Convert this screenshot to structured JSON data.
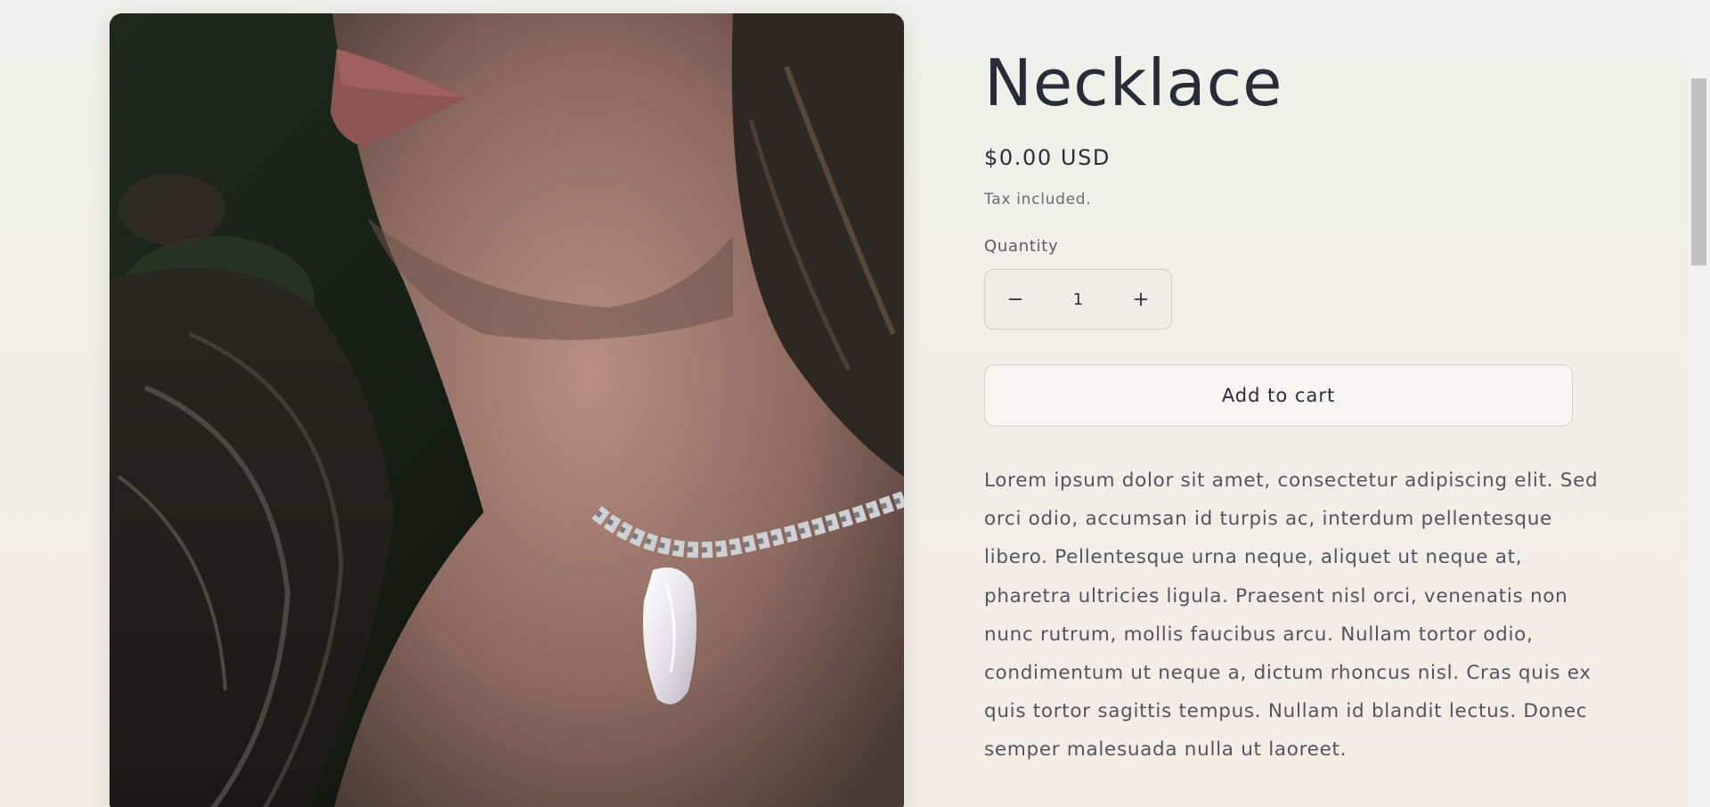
{
  "product": {
    "title": "Necklace",
    "price": "$0.00 USD",
    "tax_note": "Tax included.",
    "quantity_label": "Quantity",
    "quantity_value": "1",
    "add_to_cart_label": "Add to cart",
    "description": "Lorem ipsum dolor sit amet, consectetur adipiscing elit. Sed orci odio, accumsan id turpis ac, interdum pellentesque libero. Pellentesque urna neque, aliquet ut neque at, pharetra ultricies ligula. Praesent nisl orci, venenatis non nunc rutrum, mollis faucibus arcu. Nullam tortor odio, condimentum ut neque a, dictum rhoncus nisl. Cras quis ex quis tortor sagittis tempus. Nullam id blandit lectus. Donec semper malesuada nulla ut laoreet."
  },
  "icons": {
    "decrease": "minus-icon",
    "increase": "plus-icon"
  },
  "colors": {
    "background": "#f0efea",
    "text": "#2d2c3a",
    "muted_text": "#6b6a73",
    "button_background": "#f8f6f2",
    "border": "#cfcdc8"
  }
}
